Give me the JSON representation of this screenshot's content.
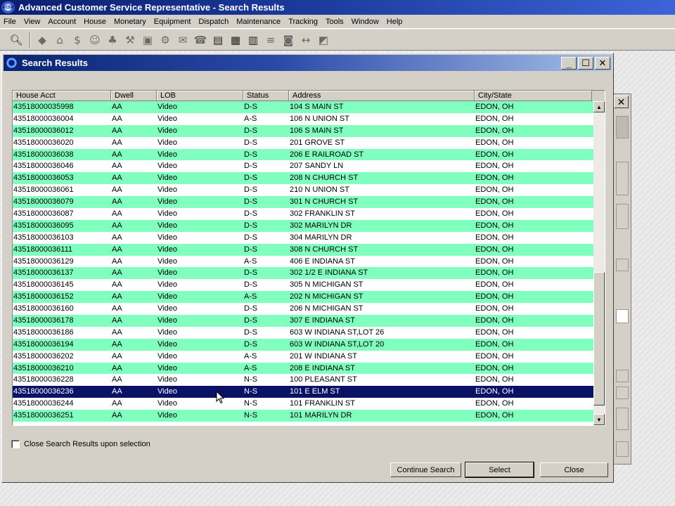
{
  "app": {
    "title": "Advanced Customer Service Representative - Search Results",
    "icon_text": "ACSR"
  },
  "menu": [
    "File",
    "View",
    "Account",
    "House",
    "Monetary",
    "Equipment",
    "Dispatch",
    "Maintenance",
    "Tracking",
    "Tools",
    "Window",
    "Help"
  ],
  "toolbar_icons": [
    "search-icon",
    "account-icon",
    "house-icon",
    "monetary-icon",
    "person-icon",
    "group-icon",
    "service-icon",
    "equipment-icon",
    "dispatch-icon",
    "mail-icon",
    "phone-icon",
    "list-icon",
    "calendar-icon",
    "report-icon",
    "tree-icon",
    "lock-icon",
    "link-icon",
    "note-icon"
  ],
  "dialog": {
    "title": "Search Results",
    "minimize": "_",
    "maximize": "☐",
    "close": "✕"
  },
  "table": {
    "columns": [
      "House Acct",
      "Dwell",
      "LOB",
      "Status",
      "Address",
      "City/State"
    ],
    "rows": [
      [
        "43518000035998",
        "AA",
        "Video",
        "D-S",
        "104 S MAIN ST",
        "EDON, OH"
      ],
      [
        "43518000036004",
        "AA",
        "Video",
        "A-S",
        "106 N UNION ST",
        "EDON, OH"
      ],
      [
        "43518000036012",
        "AA",
        "Video",
        "D-S",
        "106 S MAIN ST",
        "EDON, OH"
      ],
      [
        "43518000036020",
        "AA",
        "Video",
        "D-S",
        "201 GROVE ST",
        "EDON, OH"
      ],
      [
        "43518000036038",
        "AA",
        "Video",
        "D-S",
        "206 E RAILROAD ST",
        "EDON, OH"
      ],
      [
        "43518000036046",
        "AA",
        "Video",
        "D-S",
        "207 SANDY LN",
        "EDON, OH"
      ],
      [
        "43518000036053",
        "AA",
        "Video",
        "D-S",
        "208 N CHURCH ST",
        "EDON, OH"
      ],
      [
        "43518000036061",
        "AA",
        "Video",
        "D-S",
        "210 N UNION ST",
        "EDON, OH"
      ],
      [
        "43518000036079",
        "AA",
        "Video",
        "D-S",
        "301 N CHURCH ST",
        "EDON, OH"
      ],
      [
        "43518000036087",
        "AA",
        "Video",
        "D-S",
        "302 FRANKLIN ST",
        "EDON, OH"
      ],
      [
        "43518000036095",
        "AA",
        "Video",
        "D-S",
        "302 MARILYN DR",
        "EDON, OH"
      ],
      [
        "43518000036103",
        "AA",
        "Video",
        "D-S",
        "304 MARILYN DR",
        "EDON, OH"
      ],
      [
        "43518000036111",
        "AA",
        "Video",
        "D-S",
        "308 N CHURCH ST",
        "EDON, OH"
      ],
      [
        "43518000036129",
        "AA",
        "Video",
        "A-S",
        "406 E INDIANA ST",
        "EDON, OH"
      ],
      [
        "43518000036137",
        "AA",
        "Video",
        "D-S",
        "302 1/2 E INDIANA ST",
        "EDON, OH"
      ],
      [
        "43518000036145",
        "AA",
        "Video",
        "D-S",
        "305 N MICHIGAN ST",
        "EDON, OH"
      ],
      [
        "43518000036152",
        "AA",
        "Video",
        "A-S",
        "202 N MICHIGAN ST",
        "EDON, OH"
      ],
      [
        "43518000036160",
        "AA",
        "Video",
        "D-S",
        "206 N MICHIGAN ST",
        "EDON, OH"
      ],
      [
        "43518000036178",
        "AA",
        "Video",
        "D-S",
        "307 E INDIANA ST",
        "EDON, OH"
      ],
      [
        "43518000036186",
        "AA",
        "Video",
        "D-S",
        "603 W INDIANA ST,LOT 26",
        "EDON, OH"
      ],
      [
        "43518000036194",
        "AA",
        "Video",
        "D-S",
        "603 W INDIANA ST,LOT 20",
        "EDON, OH"
      ],
      [
        "43518000036202",
        "AA",
        "Video",
        "A-S",
        "201 W INDIANA ST",
        "EDON, OH"
      ],
      [
        "43518000036210",
        "AA",
        "Video",
        "A-S",
        "208 E INDIANA ST",
        "EDON, OH"
      ],
      [
        "43518000036228",
        "AA",
        "Video",
        "N-S",
        "100 PLEASANT ST",
        "EDON, OH"
      ],
      [
        "43518000036236",
        "AA",
        "Video",
        "N-S",
        "101 E ELM ST",
        "EDON, OH"
      ],
      [
        "43518000036244",
        "AA",
        "Video",
        "N-S",
        "101 FRANKLIN ST",
        "EDON, OH"
      ],
      [
        "43518000036251",
        "AA",
        "Video",
        "N-S",
        "101 MARILYN DR",
        "EDON, OH"
      ]
    ],
    "selected_index": 24
  },
  "close_on_select_label": "Close Search Results upon selection",
  "buttons": {
    "continue": "Continue Search",
    "select": "Select",
    "close": "Close"
  },
  "colors": {
    "row_green": "#80ffbf",
    "row_selected": "#0a1266",
    "title_blue": "#0a2470"
  }
}
